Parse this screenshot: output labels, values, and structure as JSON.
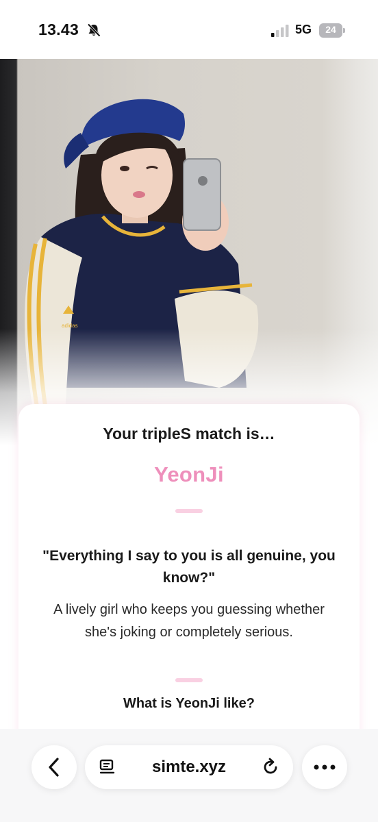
{
  "status_bar": {
    "time": "13.43",
    "network": "5G",
    "battery": "24",
    "icons": [
      "bell-slash-icon",
      "signal-icon",
      "battery-icon"
    ]
  },
  "result": {
    "heading": "Your tripleS match is…",
    "name": "YeonJi",
    "quote": "\"Everything I say to you is all genuine, you know?\"",
    "description": "A lively girl who keeps you guessing whether she's joking or completely serious.",
    "section_heading": "What is YeonJi like?"
  },
  "photo": {
    "jacket_logo": "adidas"
  },
  "browser": {
    "url": "simte.xyz",
    "icons": [
      "back-chevron-icon",
      "reader-icon",
      "reload-icon",
      "more-icon"
    ]
  },
  "colors": {
    "accent_pink": "#ee8fbb",
    "divider_pink": "#f9d0e2"
  }
}
